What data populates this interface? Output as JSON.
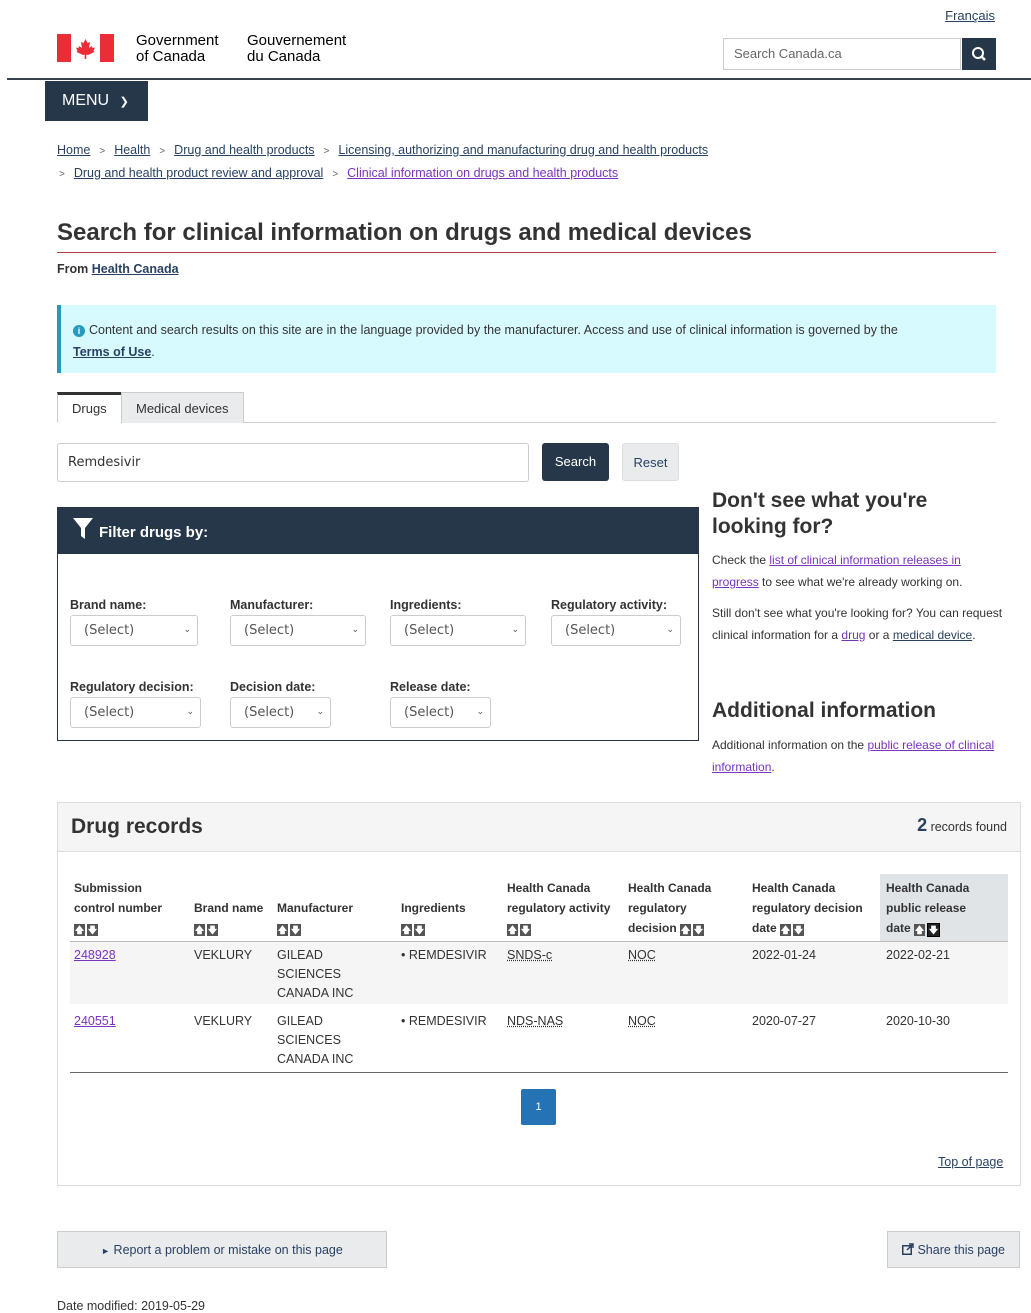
{
  "header": {
    "lang_link": "Français",
    "sig_en_1": "Government",
    "sig_en_2": "of Canada",
    "sig_fr_1": "Gouvernement",
    "sig_fr_2": "du Canada",
    "search_placeholder": "Search Canada.ca",
    "menu_label": "MENU"
  },
  "breadcrumbs": [
    "Home",
    "Health",
    "Drug and health products",
    "Licensing, authorizing and manufacturing drug and health products",
    "Drug and health product review and approval",
    "Clinical information on drugs and health products"
  ],
  "page": {
    "title": "Search for clinical information on drugs and medical devices",
    "from_label": "From",
    "from_link": "Health Canada"
  },
  "alert": {
    "text": "Content and search results on this site are in the language provided by the manufacturer. Access and use of clinical information is governed by the",
    "link": "Terms of Use",
    "end": "."
  },
  "tabs": [
    "Drugs",
    "Medical devices"
  ],
  "search": {
    "value": "Remdesivir",
    "search_label": "Search",
    "reset_label": "Reset"
  },
  "filter": {
    "title": "Filter drugs by:",
    "fields": [
      {
        "label": "Brand name:",
        "value": "(Select)"
      },
      {
        "label": "Manufacturer:",
        "value": "(Select)"
      },
      {
        "label": "Ingredients:",
        "value": "(Select)"
      },
      {
        "label": "Regulatory activity:",
        "value": "(Select)"
      },
      {
        "label": "Regulatory decision:",
        "value": "(Select)"
      },
      {
        "label": "Decision date:",
        "value": "(Select)"
      },
      {
        "label": "Release date:",
        "value": "(Select)"
      }
    ]
  },
  "sidebar": {
    "h1": "Don't see what you're looking for?",
    "p1_a": "Check the",
    "p1_link": "list of clinical information releases in progress",
    "p1_b": "to see what we're already working on.",
    "p2_a": "Still don't see what you're looking for? You can request clinical information for a",
    "p2_link1": "drug",
    "p2_or": "or a",
    "p2_link2": "medical device",
    "p2_end": ".",
    "h2": "Additional information",
    "p3_a": "Additional information on the",
    "p3_link": "public release of clinical information",
    "p3_end": "."
  },
  "records": {
    "title": "Drug records",
    "count": "2",
    "count_label": "records found",
    "headers": [
      "Submission control number",
      "Brand name",
      "Manufacturer",
      "Ingredients",
      "Health Canada regulatory activity",
      "Health Canada regulatory decision",
      "Health Canada regulatory decision date",
      "Health Canada public release date"
    ],
    "rows": [
      {
        "num": "248928",
        "brand": "VEKLURY",
        "manufacturer": "GILEAD SCIENCES CANADA INC",
        "ingredient": "REMDESIVIR",
        "activity": "SNDS-c",
        "decision": "NOC",
        "decision_date": "2022-01-24",
        "release_date": "2022-02-21"
      },
      {
        "num": "240551",
        "brand": "VEKLURY",
        "manufacturer": "GILEAD SCIENCES CANADA INC",
        "ingredient": "REMDESIVIR",
        "activity": "NDS-NAS",
        "decision": "NOC",
        "decision_date": "2020-07-27",
        "release_date": "2020-10-30"
      }
    ],
    "page": "1",
    "top_link": "Top of page"
  },
  "footer": {
    "report": "Report a problem or mistake on this page",
    "share": "Share this page",
    "modified": "Date modified: 2019-05-29"
  },
  "colors": {
    "brand": "#26374a",
    "alert_bg": "#d7faff",
    "accent_rule": "#af3c43",
    "flag_red": "#eb2d37"
  }
}
